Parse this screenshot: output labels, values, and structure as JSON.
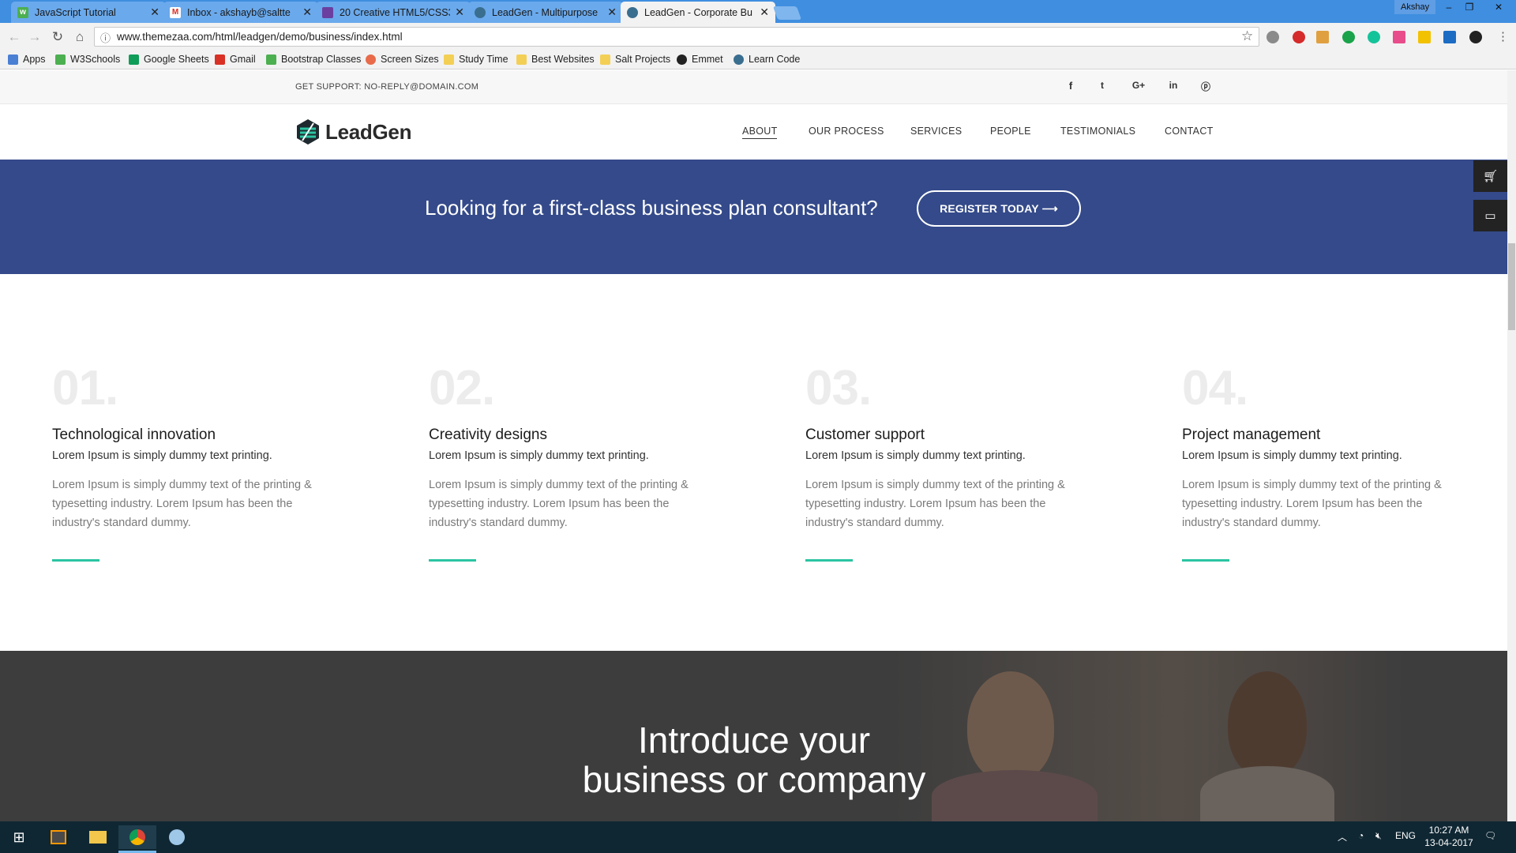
{
  "browser": {
    "tabs": [
      {
        "title": "JavaScript Tutorial",
        "icon": "w3schools-icon",
        "color": "#4caf50"
      },
      {
        "title": "Inbox - akshayb@saltte",
        "icon": "gmail-icon",
        "color": "#d93025"
      },
      {
        "title": "20 Creative HTML5/CSS3",
        "icon": "codrops-icon",
        "color": "#6b3fa0"
      },
      {
        "title": "LeadGen - Multipurpose",
        "icon": "globe-icon",
        "color": "#3a6e8f"
      },
      {
        "title": "LeadGen - Corporate Bu",
        "icon": "globe-icon",
        "color": "#3a6e8f"
      }
    ],
    "user": "Akshay",
    "url": "www.themezaa.com/html/leadgen/demo/business/index.html",
    "bookmarks": [
      "Apps",
      "W3Schools",
      "Google Sheets",
      "Gmail",
      "Bootstrap Classes",
      "Screen Sizes",
      "Study Time",
      "Best Websites",
      "Salt Projects",
      "Emmet",
      "Learn Code"
    ]
  },
  "site": {
    "support": "GET SUPPORT: NO-REPLY@DOMAIN.COM",
    "social": [
      "facebook-icon",
      "twitter-icon",
      "google-plus-icon",
      "linkedin-icon",
      "pinterest-icon"
    ],
    "logo": "LeadGen",
    "menu": [
      "ABOUT",
      "OUR PROCESS",
      "SERVICES",
      "PEOPLE",
      "TESTIMONIALS",
      "CONTACT"
    ],
    "banner": {
      "text": "Looking for a first-class business plan consultant?",
      "button": "REGISTER TODAY ⟶"
    },
    "features": [
      {
        "num": "01.",
        "title": "Technological innovation",
        "sub": "Lorem Ipsum is simply dummy text printing.",
        "desc": "Lorem Ipsum is simply dummy text of the printing & typesetting industry. Lorem Ipsum has been the industry's standard dummy."
      },
      {
        "num": "02.",
        "title": "Creativity designs",
        "sub": "Lorem Ipsum is simply dummy text printing.",
        "desc": "Lorem Ipsum is simply dummy text of the printing & typesetting industry. Lorem Ipsum has been the industry's standard dummy."
      },
      {
        "num": "03.",
        "title": "Customer support",
        "sub": "Lorem Ipsum is simply dummy text printing.",
        "desc": "Lorem Ipsum is simply dummy text of the printing & typesetting industry. Lorem Ipsum has been the industry's standard dummy."
      },
      {
        "num": "04.",
        "title": "Project management",
        "sub": "Lorem Ipsum is simply dummy text printing.",
        "desc": "Lorem Ipsum is simply dummy text of the printing & typesetting industry. Lorem Ipsum has been the industry's standard dummy."
      }
    ],
    "intro": {
      "line1": "Introduce your",
      "line2": "business or company"
    },
    "colors": {
      "banner": "#344a8a",
      "accent": "#2bc4a2",
      "dark": "#3d3d3d"
    }
  },
  "taskbar": {
    "language": "ENG",
    "time": "10:27 AM",
    "date": "13-04-2017"
  }
}
